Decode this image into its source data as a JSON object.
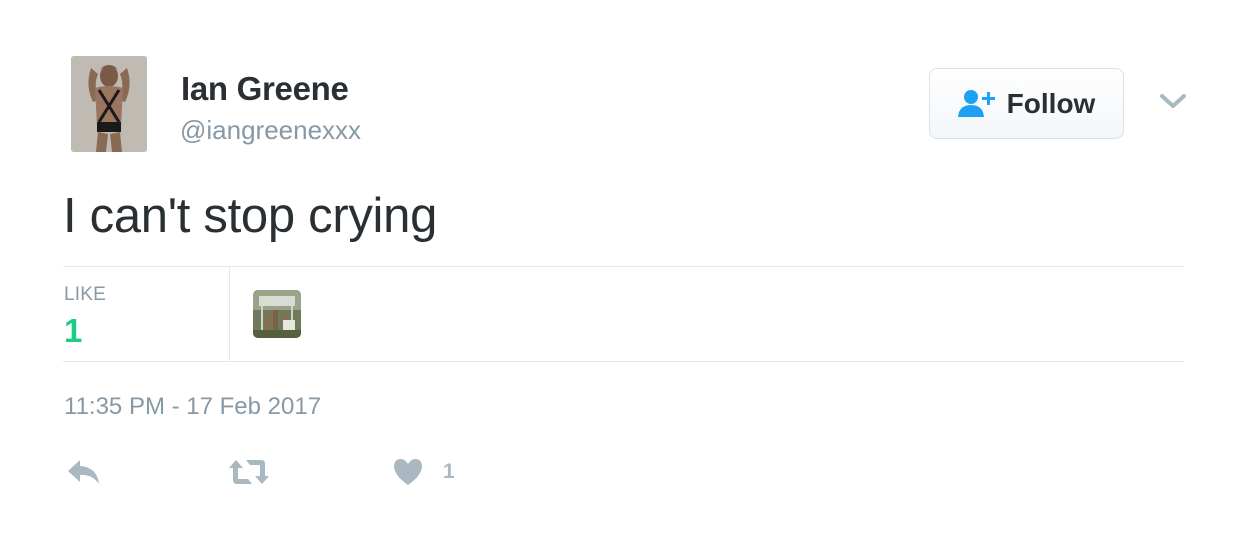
{
  "user": {
    "display_name": "Ian Greene",
    "handle": "@iangreenexxx",
    "avatar_icon": "profile-photo"
  },
  "follow_button": {
    "label": "Follow",
    "icon": "add-user-icon",
    "icon_color": "#1da1f2"
  },
  "menu": {
    "icon": "chevron-down-icon"
  },
  "tweet": {
    "text": "I can't stop crying",
    "timestamp": "11:35 PM - 17 Feb 2017"
  },
  "stats": {
    "likes_label": "LIKE",
    "likes_value": "1",
    "likes_color": "#19cf86"
  },
  "actions": {
    "reply_icon": "reply-icon",
    "retweet_icon": "retweet-icon",
    "like_icon": "heart-icon",
    "like_count": "1",
    "icon_color": "#aab8c2"
  },
  "colors": {
    "text_primary": "#292f33",
    "text_secondary": "#8899a6",
    "border": "#e1e8ed"
  }
}
